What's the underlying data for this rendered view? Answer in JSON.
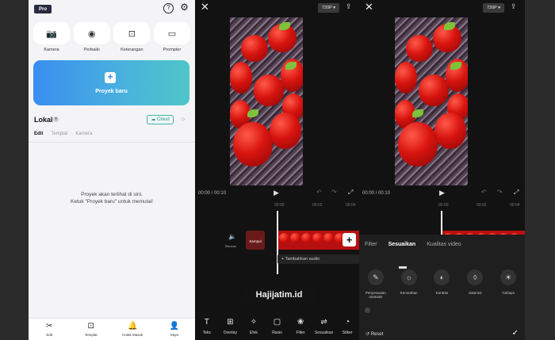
{
  "home": {
    "badge": "Pro",
    "help_icon": "?",
    "settings_icon": "⚙",
    "quick_actions": [
      {
        "label": "Kamera",
        "icon": "camera-icon",
        "glyph": "📷"
      },
      {
        "label": "Perbaiki",
        "icon": "enhance-icon",
        "glyph": "◉"
      },
      {
        "label": "Keterangan",
        "icon": "caption-icon",
        "glyph": "⊡"
      },
      {
        "label": "Prompter",
        "icon": "prompter-icon",
        "glyph": "▭"
      }
    ],
    "new_project": {
      "plus": "+",
      "label": "Proyek baru"
    },
    "section_title": "Lokal",
    "cloud_button": "☁ Cloud",
    "tabs": [
      "Edit",
      "Templat",
      "Kamera"
    ],
    "empty_line1": "Proyek akan terlihat di sini.",
    "empty_line2": "Ketuk \"Proyek baru\" untuk memulai!",
    "bottom_nav": [
      {
        "label": "Edit",
        "icon": "scissors-icon",
        "glyph": "✂"
      },
      {
        "label": "Templat",
        "icon": "template-icon",
        "glyph": "⊡"
      },
      {
        "label": "Kotak Masuk",
        "icon": "bell-icon",
        "glyph": "🔔"
      },
      {
        "label": "Saya",
        "icon": "user-icon",
        "glyph": "👤"
      }
    ]
  },
  "editor": {
    "close_icon": "✕",
    "resolution": "720P ▾",
    "export_icon": "⇪",
    "time": "00:00 / 00:10",
    "play_icon": "▶",
    "undo_icon": "↶",
    "redo_icon": "↷",
    "fullscreen_icon": "⤢",
    "ruler": [
      "00:00",
      "00:02",
      "00:04"
    ],
    "sound_label": "Bisukan",
    "cover_label": "Sampul",
    "add_clip": "+",
    "add_audio": "+ Tambahkan audio",
    "toolbar": [
      {
        "label": "Teks",
        "icon": "text-icon",
        "glyph": "T"
      },
      {
        "label": "Overlay",
        "icon": "overlay-icon",
        "glyph": "⊞"
      },
      {
        "label": "Efek",
        "icon": "effect-icon",
        "glyph": "✧"
      },
      {
        "label": "Rasio",
        "icon": "ratio-icon",
        "glyph": "▢"
      },
      {
        "label": "Filter",
        "icon": "filter-icon",
        "glyph": "❀"
      },
      {
        "label": "Sesuaikan",
        "icon": "adjust-icon",
        "glyph": "⇌"
      },
      {
        "label": "Stiker",
        "icon": "sticker-icon",
        "glyph": "◔"
      }
    ]
  },
  "adjust": {
    "tabs": [
      "Filter",
      "Sesuaikan",
      "Kualitas video"
    ],
    "items": [
      {
        "label": "Penyesuaian otomatis",
        "icon": "auto-adjust-icon",
        "glyph": "✎"
      },
      {
        "label": "Kecerahan",
        "icon": "brightness-icon",
        "glyph": "☼"
      },
      {
        "label": "Kontras",
        "icon": "contrast-icon",
        "glyph": "◐"
      },
      {
        "label": "Saturasi",
        "icon": "saturation-icon",
        "glyph": "◊"
      },
      {
        "label": "Cahaya",
        "icon": "light-icon",
        "glyph": "☀"
      }
    ],
    "reset": "Reset",
    "confirm": "✓"
  },
  "watermark": "Hajijatim.id",
  "colors": {
    "accent": "#3a8ef0",
    "teal": "#20a090",
    "editor_bg": "#121212"
  }
}
